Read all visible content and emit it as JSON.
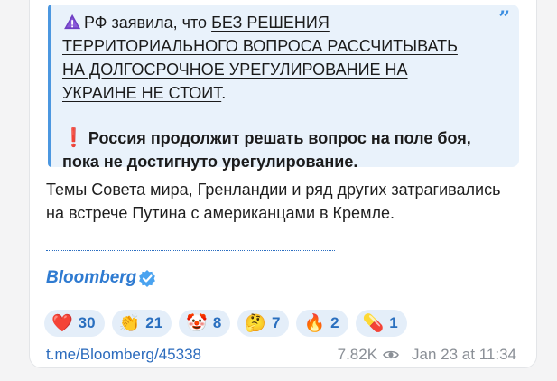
{
  "quote": {
    "mark": "”",
    "p1_prefix": "РФ заявила, что ",
    "p1_underlined": "БЕЗ РЕШЕНИЯ ТЕРРИТОРИАЛЬНОГО ВОПРОСА РАССЧИТЫВАТЬ НА ДОЛГОСРОЧНОЕ УРЕГУЛИРОВАНИЕ НА УКРАИНЕ НЕ СТОИТ",
    "p1_suffix": ".",
    "p2_icon": "❗",
    "p2_text": "Россия продолжит решать вопрос на поле боя, пока не достигнуто урегулирование."
  },
  "body_text": "Темы Совета мира, Гренландии и ряд других затрагивались на встрече Путина с американцами в Кремле.",
  "brand": {
    "name": "Bloomberg",
    "verified_icon": "verified-badge-icon",
    "color": "#2f7bd1"
  },
  "reactions": [
    {
      "emoji": "❤️",
      "count": "30",
      "name": "heart"
    },
    {
      "emoji": "👏",
      "count": "21",
      "name": "clap"
    },
    {
      "emoji": "🤡",
      "count": "8",
      "name": "clown"
    },
    {
      "emoji": "🤔",
      "count": "7",
      "name": "thinking"
    },
    {
      "emoji": "🔥",
      "count": "2",
      "name": "fire"
    },
    {
      "emoji": "💊",
      "count": "1",
      "name": "pill"
    }
  ],
  "footer": {
    "link": "t.me/Bloomberg/45338",
    "views": "7.82K",
    "date": "Jan 23 at 11:34"
  },
  "colors": {
    "accent": "#2f7bd1",
    "quote_bg": "#e9f2fb",
    "quote_border": "#4b97e0",
    "alert_red": "#e11d23"
  }
}
